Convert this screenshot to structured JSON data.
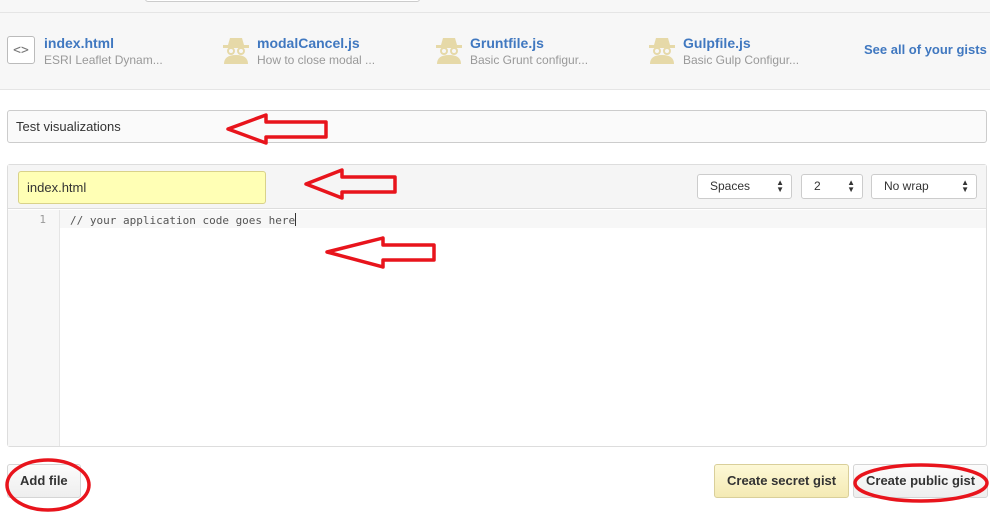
{
  "gists": [
    {
      "name": "index.html",
      "description": "ESRI Leaflet Dynam...",
      "icon": "code-file-icon"
    },
    {
      "name": "modalCancel.js",
      "description": "How to close modal ...",
      "icon": "anonymous-user-icon"
    },
    {
      "name": "Gruntfile.js",
      "description": "Basic Grunt configur...",
      "icon": "anonymous-user-icon"
    },
    {
      "name": "Gulpfile.js",
      "description": "Basic Gulp Configur...",
      "icon": "anonymous-user-icon"
    }
  ],
  "see_all": "See all of your gists",
  "description_input": {
    "value": "Test visualizations"
  },
  "editor": {
    "filename": "index.html",
    "indent_mode": "Spaces",
    "indent_size": "2",
    "wrap_mode": "No wrap",
    "line_number": "1",
    "code": "// your application code goes here"
  },
  "buttons": {
    "add_file": "Add file",
    "create_secret": "Create secret gist",
    "create_public": "Create public gist"
  },
  "colors": {
    "link": "#4078c0",
    "filename_highlight": "#ffffb5",
    "annotation_red": "#e8141c"
  }
}
